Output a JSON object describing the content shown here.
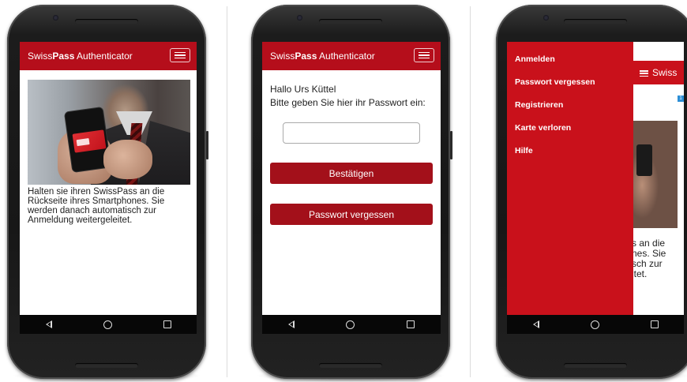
{
  "app": {
    "title_plain": "Swiss",
    "title_bold": "Pass",
    "title_rest": " Authenticator"
  },
  "screen1": {
    "instruction": "Halten sie ihren SwissPass an die Rückseite ihres Smartphones. Sie werden danach automatisch zur Anmeldung weitergeleitet."
  },
  "screen2": {
    "greeting": "Hallo Urs Küttel",
    "prompt": "Bitte geben Sie hier ihr Passwort ein:",
    "password_value": "",
    "confirm_label": "Bestätigen",
    "forgot_label": "Passwort vergessen"
  },
  "screen3": {
    "menu": [
      {
        "label": "Anmelden"
      },
      {
        "label": "Passwort vergessen"
      },
      {
        "label": "Registrieren"
      },
      {
        "label": "Karte verloren"
      },
      {
        "label": "Hilfe"
      }
    ],
    "partial_title": "Swiss",
    "partial_text_lines": [
      "s an die",
      "nes. Sie",
      "sch zur",
      "itet."
    ],
    "badge": "1"
  },
  "colors": {
    "brand_red": "#b50e1b",
    "button_red": "#a3101a",
    "drawer_red": "#c9111b"
  },
  "icons": {
    "menu": "hamburger-icon",
    "back": "back-triangle-icon",
    "home": "home-circle-icon",
    "recent": "recent-square-icon"
  }
}
